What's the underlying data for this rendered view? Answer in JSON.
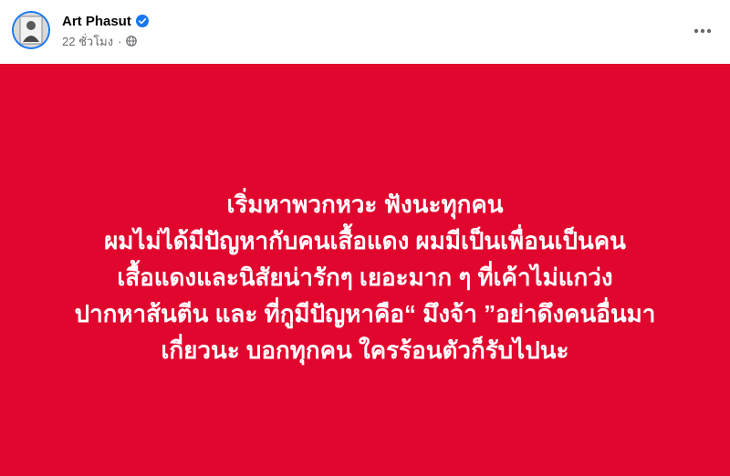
{
  "author": {
    "name": "Art Phasut",
    "verified": true
  },
  "meta": {
    "time": "22 ชั่วโมง",
    "separator": "·",
    "audience_icon": "globe-icon"
  },
  "more_icon": "ellipsis-horizontal-icon",
  "post": {
    "background_color": "#e1062e",
    "text_color": "#ffffff",
    "lines": [
      "เริ่มหาพวกหวะ ฟังนะทุกคน",
      "ผมไม่ได้มีปัญหากับคนเสื้อแดง ผมมีเป็นเพื่อนเป็นคน",
      "เสื้อแดงและนิสัยน่ารักๆ เยอะมาก ๆ ที่เค้าไม่แกว่ง",
      "ปากหาส้นตีน และ ที่กูมีปัญหาคือ“ มึงจ้า ”อย่าดึงคนอื่นมา",
      "เกี่ยวนะ บอกทุกคน ใครร้อนตัวก็รับไปนะ"
    ]
  },
  "colors": {
    "verified_badge": "#1877f2",
    "secondary_text": "#65676b"
  }
}
